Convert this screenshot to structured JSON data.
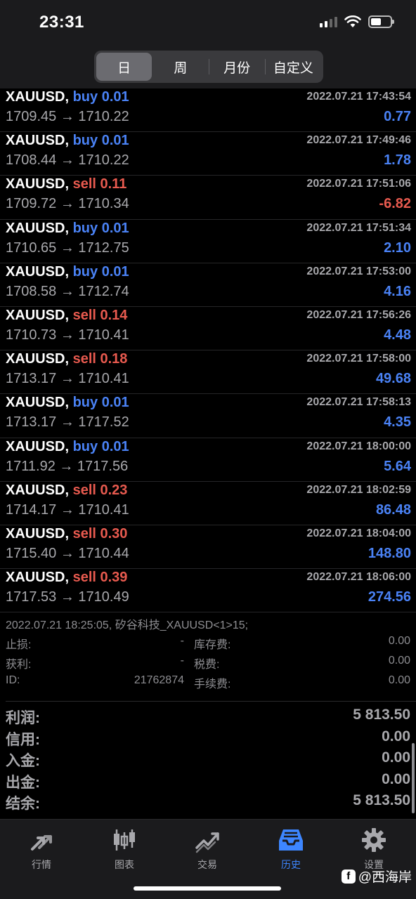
{
  "status_bar": {
    "time": "23:31",
    "battery_level": 0.55
  },
  "periods": [
    {
      "label": "日",
      "active": true
    },
    {
      "label": "周",
      "active": false
    },
    {
      "label": "月份",
      "active": false
    },
    {
      "label": "自定义",
      "active": false
    }
  ],
  "deals": [
    {
      "symbol": "XAUUSD,",
      "side": "buy",
      "lot": "buy 0.01",
      "time": "2022.07.21 17:43:54",
      "prices": "1709.45 → 1710.22",
      "profit": "0.77"
    },
    {
      "symbol": "XAUUSD,",
      "side": "buy",
      "lot": "buy 0.01",
      "time": "2022.07.21 17:49:46",
      "prices": "1708.44 → 1710.22",
      "profit": "1.78"
    },
    {
      "symbol": "XAUUSD,",
      "side": "sell",
      "lot": "sell 0.11",
      "time": "2022.07.21 17:51:06",
      "prices": "1709.72 → 1710.34",
      "profit": "-6.82"
    },
    {
      "symbol": "XAUUSD,",
      "side": "buy",
      "lot": "buy 0.01",
      "time": "2022.07.21 17:51:34",
      "prices": "1710.65 → 1712.75",
      "profit": "2.10"
    },
    {
      "symbol": "XAUUSD,",
      "side": "buy",
      "lot": "buy 0.01",
      "time": "2022.07.21 17:53:00",
      "prices": "1708.58 → 1712.74",
      "profit": "4.16"
    },
    {
      "symbol": "XAUUSD,",
      "side": "sell",
      "lot": "sell 0.14",
      "time": "2022.07.21 17:56:26",
      "prices": "1710.73 → 1710.41",
      "profit": "4.48"
    },
    {
      "symbol": "XAUUSD,",
      "side": "sell",
      "lot": "sell 0.18",
      "time": "2022.07.21 17:58:00",
      "prices": "1713.17 → 1710.41",
      "profit": "49.68"
    },
    {
      "symbol": "XAUUSD,",
      "side": "buy",
      "lot": "buy 0.01",
      "time": "2022.07.21 17:58:13",
      "prices": "1713.17 → 1717.52",
      "profit": "4.35"
    },
    {
      "symbol": "XAUUSD,",
      "side": "buy",
      "lot": "buy 0.01",
      "time": "2022.07.21 18:00:00",
      "prices": "1711.92 → 1717.56",
      "profit": "5.64"
    },
    {
      "symbol": "XAUUSD,",
      "side": "sell",
      "lot": "sell 0.23",
      "time": "2022.07.21 18:02:59",
      "prices": "1714.17 → 1710.41",
      "profit": "86.48"
    },
    {
      "symbol": "XAUUSD,",
      "side": "sell",
      "lot": "sell 0.30",
      "time": "2022.07.21 18:04:00",
      "prices": "1715.40 → 1710.44",
      "profit": "148.80"
    },
    {
      "symbol": "XAUUSD,",
      "side": "sell",
      "lot": "sell 0.39",
      "time": "2022.07.21 18:06:00",
      "prices": "1717.53 → 1710.49",
      "profit": "274.56"
    }
  ],
  "detail": {
    "title": "2022.07.21 18:25:05, 矽谷科技_XAUUSD<1>15;",
    "rows": [
      {
        "label1": "止损:",
        "value1": "-",
        "label2": "库存费:",
        "value2": "0.00"
      },
      {
        "label1": "获利:",
        "value1": "-",
        "label2": "税费:",
        "value2": "0.00"
      },
      {
        "label1": "ID:",
        "value1": "21762874",
        "label2": "手续费:",
        "value2": "0.00"
      }
    ]
  },
  "summary": [
    {
      "label": "利润:",
      "value": "5 813.50"
    },
    {
      "label": "信用:",
      "value": "0.00"
    },
    {
      "label": "入金:",
      "value": "0.00"
    },
    {
      "label": "出金:",
      "value": "0.00"
    },
    {
      "label": "结余:",
      "value": "5 813.50"
    }
  ],
  "tabs": [
    {
      "label": "行情",
      "icon": "quotes-arrows-icon",
      "active": false
    },
    {
      "label": "图表",
      "icon": "candlestick-chart-icon",
      "active": false
    },
    {
      "label": "交易",
      "icon": "trade-chart-icon",
      "active": false
    },
    {
      "label": "历史",
      "icon": "history-inbox-icon",
      "active": true
    },
    {
      "label": "设置",
      "icon": "gear-icon",
      "active": false
    }
  ],
  "colors": {
    "buy": "#4a82f5",
    "sell": "#e85a4f",
    "active_tab": "#3d86ff"
  },
  "watermark": {
    "text": "@西海岸",
    "logo_icon": "weibo-logo-icon"
  }
}
